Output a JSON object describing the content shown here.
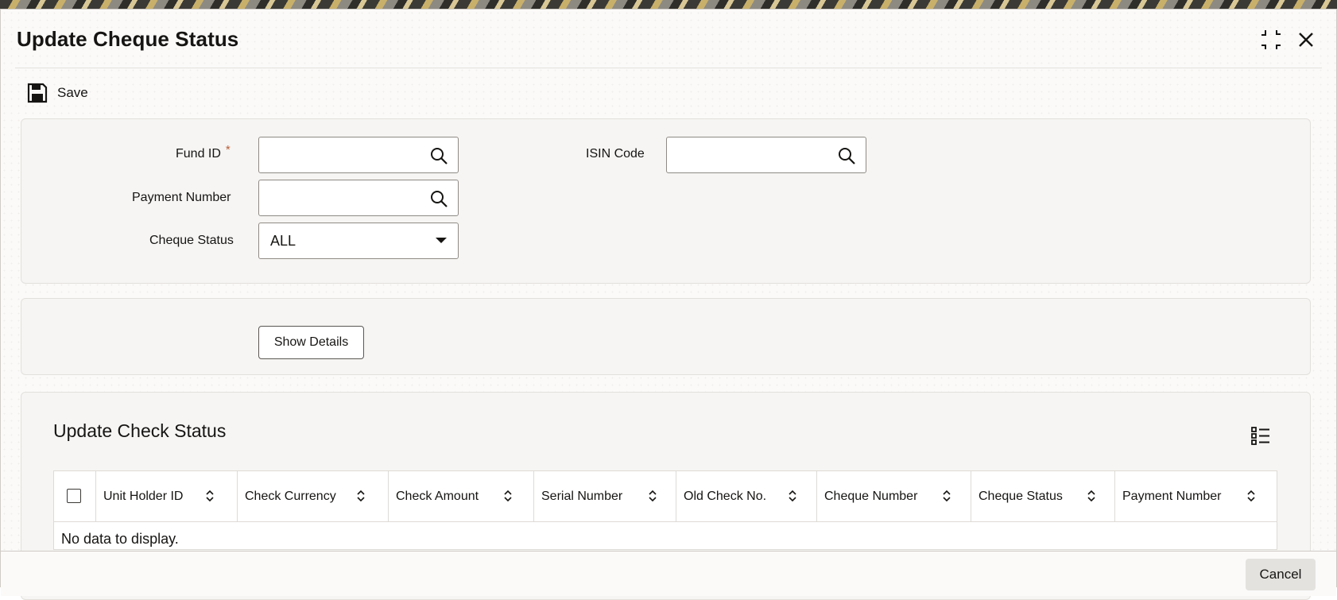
{
  "window": {
    "title": "Update Cheque Status"
  },
  "toolbar": {
    "save_label": "Save"
  },
  "form": {
    "fund_id_label": "Fund ID",
    "required_mark": "*",
    "fund_id_value": "",
    "payment_number_label": "Payment Number",
    "payment_number_value": "",
    "cheque_status_label": "Cheque Status",
    "cheque_status_value": "ALL",
    "isin_code_label": "ISIN Code",
    "isin_code_value": ""
  },
  "actions": {
    "show_details_label": "Show Details"
  },
  "grid": {
    "title": "Update Check Status",
    "columns": [
      "Unit Holder ID",
      "Check Currency",
      "Check Amount",
      "Serial Number",
      "Old Check No.",
      "Cheque Number",
      "Cheque Status",
      "Payment Number"
    ],
    "empty_message": "No data to display."
  },
  "footer": {
    "cancel_label": "Cancel"
  },
  "icons": {
    "save": "save-icon",
    "search": "search-icon",
    "dropdown": "chevron-down-icon",
    "maximize": "maximize-icon",
    "close": "close-icon",
    "column_chooser": "list-icon",
    "sort": "sort-icon"
  }
}
